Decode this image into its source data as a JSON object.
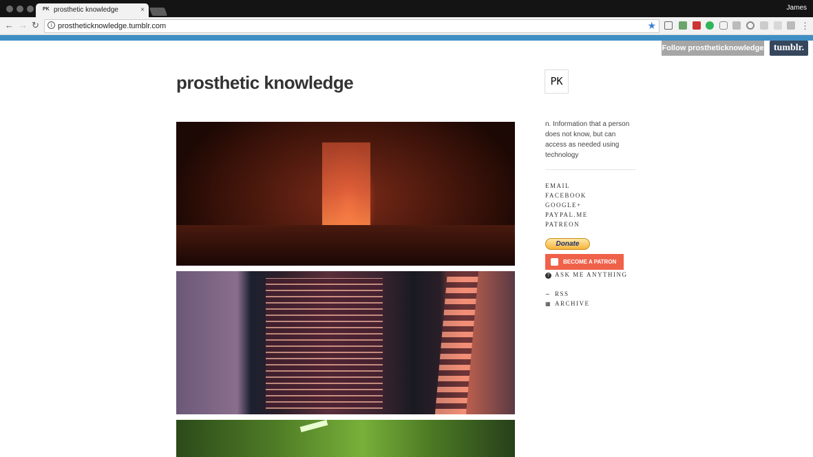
{
  "browser": {
    "tab_title": "prosthetic knowledge",
    "tab_favicon": "PK",
    "tab_close": "×",
    "user": "James",
    "url": "prostheticknowledge.tumblr.com",
    "icons": [
      "back-icon",
      "forward-icon",
      "reload-icon",
      "info-icon",
      "bookmark-star-icon",
      "menu-icon"
    ]
  },
  "tumblr_bar": {
    "follow_label": "Follow prostheticknowledge",
    "logo_label": "tumblr."
  },
  "blog": {
    "title": "prosthetic knowledge",
    "avatar_text": "PK",
    "description": "n. Information that a person does not know, but can access as needed using technology"
  },
  "sidebar": {
    "links": [
      "EMAIL",
      "FACEBOOK",
      "GOOGLE+",
      "PAYPAL.ME",
      "PATREON"
    ],
    "donate_label": "Donate",
    "patron_label": "BECOME A PATRON",
    "ask_label": "ASK ME ANYTHING",
    "rss_label": "RSS",
    "archive_label": "ARCHIVE"
  },
  "colors": {
    "accent_bar": "#3f8fc5",
    "patron": "#f0614a",
    "tumblr": "#36465d"
  }
}
